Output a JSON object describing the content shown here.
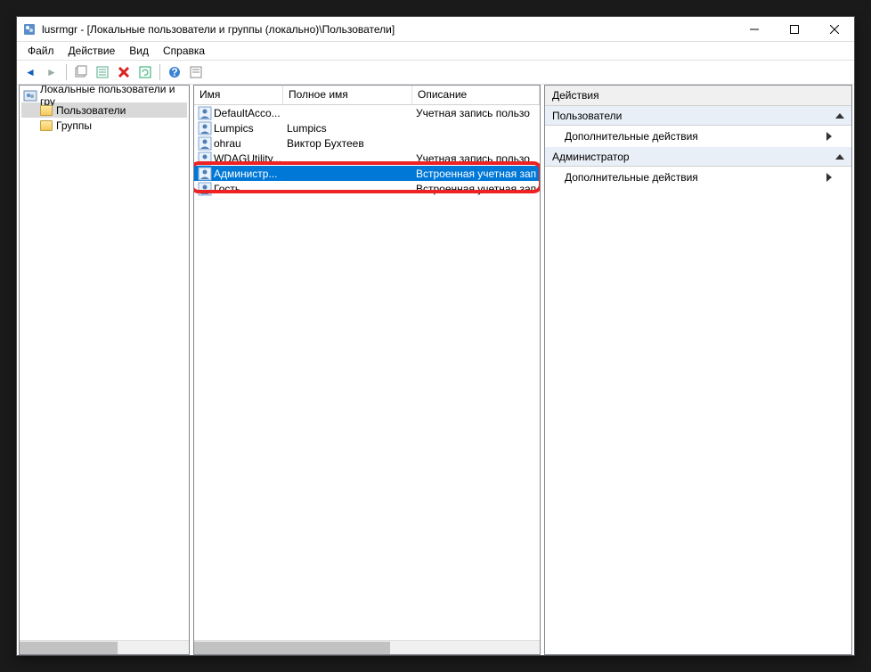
{
  "title": "lusrmgr - [Локальные пользователи и группы (локально)\\Пользователи]",
  "menu": {
    "file": "Файл",
    "action": "Действие",
    "view": "Вид",
    "help": "Справка"
  },
  "tree": {
    "root": "Локальные пользователи и гру",
    "users": "Пользователи",
    "groups": "Группы"
  },
  "columns": {
    "name": "Имя",
    "fullname": "Полное имя",
    "desc": "Описание"
  },
  "rows": [
    {
      "name": "DefaultAcco...",
      "fullname": "",
      "desc": "Учетная запись пользо"
    },
    {
      "name": "Lumpics",
      "fullname": "Lumpics",
      "desc": ""
    },
    {
      "name": "ohrau",
      "fullname": "Виктор Бухтеев",
      "desc": ""
    },
    {
      "name": "WDAGUtility...",
      "fullname": "",
      "desc": "Учетная запись пользо"
    },
    {
      "name": "Администр...",
      "fullname": "",
      "desc": "Встроенная учетная зап"
    },
    {
      "name": "Гость",
      "fullname": "",
      "desc": "Встроенная учетная зап"
    }
  ],
  "actions": {
    "title": "Действия",
    "section1": "Пользователи",
    "link": "Дополнительные действия",
    "section2": "Администратор"
  }
}
